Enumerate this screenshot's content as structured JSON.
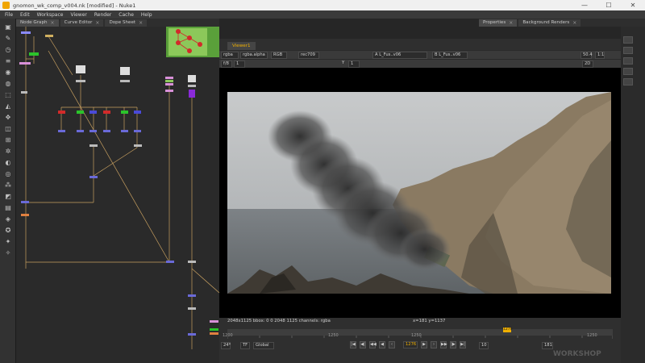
{
  "window": {
    "title": "gnomon_wk_comp_v004.nk [modified] - Nuke1",
    "minimize": "—",
    "maximize": "☐",
    "close": "✕"
  },
  "menu": [
    "File",
    "Edit",
    "Workspace",
    "Viewer",
    "Render",
    "Cache",
    "Help"
  ],
  "left_tabs": [
    {
      "label": "Node Graph"
    },
    {
      "label": "Curve Editor"
    },
    {
      "label": "Dope Sheet"
    }
  ],
  "right_tabs": [
    {
      "label": "Properties"
    },
    {
      "label": "Background Renders"
    }
  ],
  "viewer": {
    "tab": "Viewer1",
    "channels": "rgba",
    "alpha": "rgba.alpha",
    "colorspace": "RGB",
    "lut": "rec709",
    "input_a": "A  L_Fus..v06",
    "input_b": "B  L_Fus..v06",
    "zoom": "50.4",
    "ratio": "1:1",
    "mode": "2D",
    "fstop": "f/8",
    "gain_value": "1",
    "gamma_label": "Y",
    "gamma_value": "1",
    "format_info": "2048x1125  bbox: 0 0 2048 1125 channels: rgba",
    "cursor_info": "x=181 y=1137"
  },
  "timeline": {
    "start_frame": "1200",
    "mid_label_1": "1250",
    "mid_label_2": "1250",
    "end_frame": "1250",
    "current_frame": "1276",
    "marker": "1276",
    "fps": "24*",
    "tf": "TF",
    "scope": "Global",
    "step": "10",
    "range_end": "181"
  },
  "watermark": "WORKSHOP",
  "colors": {
    "accent": "#f0b000",
    "node_red": "#d22a2a",
    "node_green": "#2bc42b",
    "node_blue": "#4a4ad8",
    "node_pink": "#d890d8",
    "node_purple": "#8a2ad8",
    "backdrop_green": "#5aa03a",
    "pipe": "#d0b060"
  }
}
